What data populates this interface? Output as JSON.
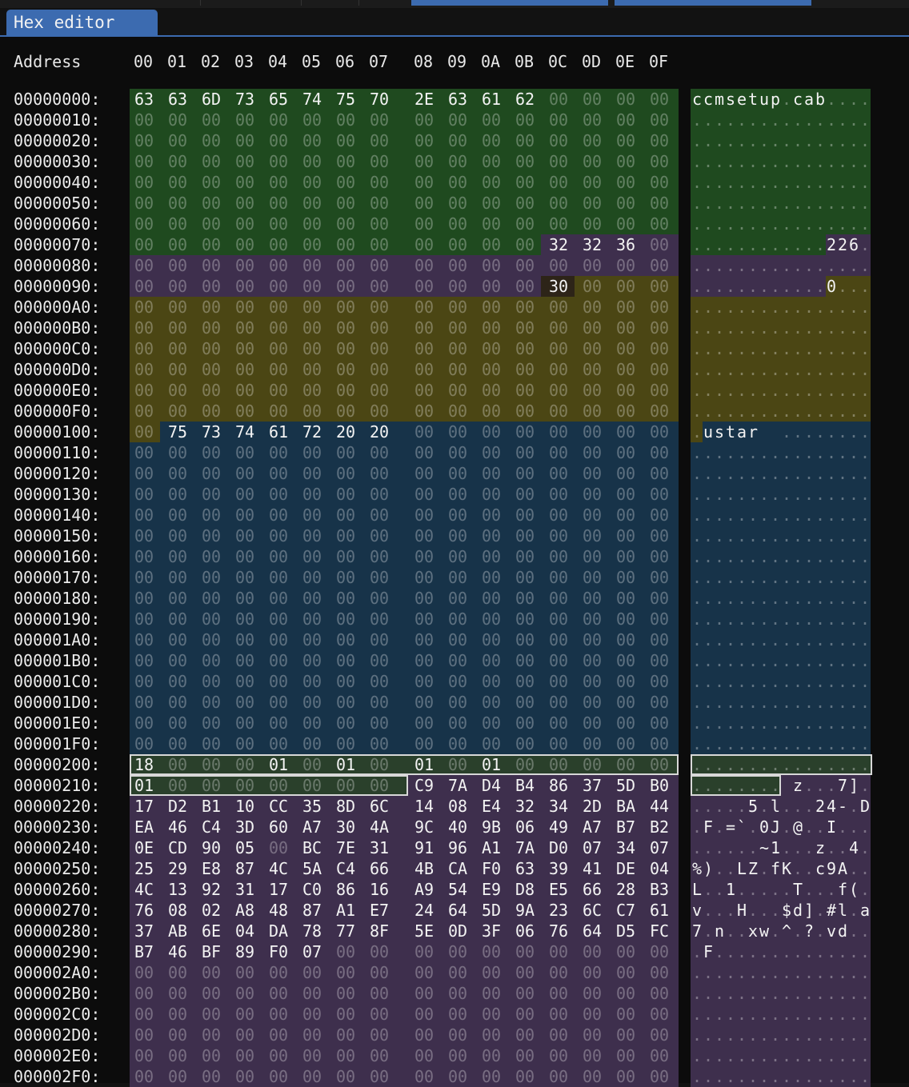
{
  "tab": {
    "label": "Hex editor"
  },
  "header": {
    "address_label": "Address",
    "columns": [
      "00",
      "01",
      "02",
      "03",
      "04",
      "05",
      "06",
      "07",
      "08",
      "09",
      "0A",
      "0B",
      "0C",
      "0D",
      "0E",
      "0F"
    ]
  },
  "colors": {
    "tab_accent": "#3c6bb0",
    "region_green": "#1f4a1f",
    "region_purple": "#3e2f4d",
    "region_olive": "#4b4614",
    "region_blue": "#173349",
    "region_selected": "#2a402b"
  },
  "regions": [
    {
      "color": "region_green",
      "start": 0,
      "end": 124
    },
    {
      "color": "region_purple",
      "start": 124,
      "end": 155
    },
    {
      "color": "region_olive",
      "start": 156,
      "end": 256
    },
    {
      "color": "region_blue",
      "start": 257,
      "end": 511
    },
    {
      "color": "region_selected",
      "start": 512,
      "end": 535
    },
    {
      "color": "region_purple",
      "start": 536,
      "end": 767
    }
  ],
  "selection": {
    "start": 512,
    "end": 535
  },
  "highlight_cells": [
    156
  ],
  "rows": [
    {
      "address": "00000000:",
      "bytes": [
        "63",
        "63",
        "6D",
        "73",
        "65",
        "74",
        "75",
        "70",
        "2E",
        "63",
        "61",
        "62",
        "00",
        "00",
        "00",
        "00"
      ],
      "ascii": "ccmsetup.cab...."
    },
    {
      "address": "00000010:",
      "bytes": [
        "00",
        "00",
        "00",
        "00",
        "00",
        "00",
        "00",
        "00",
        "00",
        "00",
        "00",
        "00",
        "00",
        "00",
        "00",
        "00"
      ],
      "ascii": "................"
    },
    {
      "address": "00000020:",
      "bytes": [
        "00",
        "00",
        "00",
        "00",
        "00",
        "00",
        "00",
        "00",
        "00",
        "00",
        "00",
        "00",
        "00",
        "00",
        "00",
        "00"
      ],
      "ascii": "................"
    },
    {
      "address": "00000030:",
      "bytes": [
        "00",
        "00",
        "00",
        "00",
        "00",
        "00",
        "00",
        "00",
        "00",
        "00",
        "00",
        "00",
        "00",
        "00",
        "00",
        "00"
      ],
      "ascii": "................"
    },
    {
      "address": "00000040:",
      "bytes": [
        "00",
        "00",
        "00",
        "00",
        "00",
        "00",
        "00",
        "00",
        "00",
        "00",
        "00",
        "00",
        "00",
        "00",
        "00",
        "00"
      ],
      "ascii": "................"
    },
    {
      "address": "00000050:",
      "bytes": [
        "00",
        "00",
        "00",
        "00",
        "00",
        "00",
        "00",
        "00",
        "00",
        "00",
        "00",
        "00",
        "00",
        "00",
        "00",
        "00"
      ],
      "ascii": "................"
    },
    {
      "address": "00000060:",
      "bytes": [
        "00",
        "00",
        "00",
        "00",
        "00",
        "00",
        "00",
        "00",
        "00",
        "00",
        "00",
        "00",
        "00",
        "00",
        "00",
        "00"
      ],
      "ascii": "................"
    },
    {
      "address": "00000070:",
      "bytes": [
        "00",
        "00",
        "00",
        "00",
        "00",
        "00",
        "00",
        "00",
        "00",
        "00",
        "00",
        "00",
        "32",
        "32",
        "36",
        "00"
      ],
      "ascii": "............226."
    },
    {
      "address": "00000080:",
      "bytes": [
        "00",
        "00",
        "00",
        "00",
        "00",
        "00",
        "00",
        "00",
        "00",
        "00",
        "00",
        "00",
        "00",
        "00",
        "00",
        "00"
      ],
      "ascii": "................"
    },
    {
      "address": "00000090:",
      "bytes": [
        "00",
        "00",
        "00",
        "00",
        "00",
        "00",
        "00",
        "00",
        "00",
        "00",
        "00",
        "00",
        "30",
        "00",
        "00",
        "00"
      ],
      "ascii": "............0..."
    },
    {
      "address": "000000A0:",
      "bytes": [
        "00",
        "00",
        "00",
        "00",
        "00",
        "00",
        "00",
        "00",
        "00",
        "00",
        "00",
        "00",
        "00",
        "00",
        "00",
        "00"
      ],
      "ascii": "................"
    },
    {
      "address": "000000B0:",
      "bytes": [
        "00",
        "00",
        "00",
        "00",
        "00",
        "00",
        "00",
        "00",
        "00",
        "00",
        "00",
        "00",
        "00",
        "00",
        "00",
        "00"
      ],
      "ascii": "................"
    },
    {
      "address": "000000C0:",
      "bytes": [
        "00",
        "00",
        "00",
        "00",
        "00",
        "00",
        "00",
        "00",
        "00",
        "00",
        "00",
        "00",
        "00",
        "00",
        "00",
        "00"
      ],
      "ascii": "................"
    },
    {
      "address": "000000D0:",
      "bytes": [
        "00",
        "00",
        "00",
        "00",
        "00",
        "00",
        "00",
        "00",
        "00",
        "00",
        "00",
        "00",
        "00",
        "00",
        "00",
        "00"
      ],
      "ascii": "................"
    },
    {
      "address": "000000E0:",
      "bytes": [
        "00",
        "00",
        "00",
        "00",
        "00",
        "00",
        "00",
        "00",
        "00",
        "00",
        "00",
        "00",
        "00",
        "00",
        "00",
        "00"
      ],
      "ascii": "................"
    },
    {
      "address": "000000F0:",
      "bytes": [
        "00",
        "00",
        "00",
        "00",
        "00",
        "00",
        "00",
        "00",
        "00",
        "00",
        "00",
        "00",
        "00",
        "00",
        "00",
        "00"
      ],
      "ascii": "................"
    },
    {
      "address": "00000100:",
      "bytes": [
        "00",
        "75",
        "73",
        "74",
        "61",
        "72",
        "20",
        "20",
        "00",
        "00",
        "00",
        "00",
        "00",
        "00",
        "00",
        "00"
      ],
      "ascii": ".ustar  ........"
    },
    {
      "address": "00000110:",
      "bytes": [
        "00",
        "00",
        "00",
        "00",
        "00",
        "00",
        "00",
        "00",
        "00",
        "00",
        "00",
        "00",
        "00",
        "00",
        "00",
        "00"
      ],
      "ascii": "................"
    },
    {
      "address": "00000120:",
      "bytes": [
        "00",
        "00",
        "00",
        "00",
        "00",
        "00",
        "00",
        "00",
        "00",
        "00",
        "00",
        "00",
        "00",
        "00",
        "00",
        "00"
      ],
      "ascii": "................"
    },
    {
      "address": "00000130:",
      "bytes": [
        "00",
        "00",
        "00",
        "00",
        "00",
        "00",
        "00",
        "00",
        "00",
        "00",
        "00",
        "00",
        "00",
        "00",
        "00",
        "00"
      ],
      "ascii": "................"
    },
    {
      "address": "00000140:",
      "bytes": [
        "00",
        "00",
        "00",
        "00",
        "00",
        "00",
        "00",
        "00",
        "00",
        "00",
        "00",
        "00",
        "00",
        "00",
        "00",
        "00"
      ],
      "ascii": "................"
    },
    {
      "address": "00000150:",
      "bytes": [
        "00",
        "00",
        "00",
        "00",
        "00",
        "00",
        "00",
        "00",
        "00",
        "00",
        "00",
        "00",
        "00",
        "00",
        "00",
        "00"
      ],
      "ascii": "................"
    },
    {
      "address": "00000160:",
      "bytes": [
        "00",
        "00",
        "00",
        "00",
        "00",
        "00",
        "00",
        "00",
        "00",
        "00",
        "00",
        "00",
        "00",
        "00",
        "00",
        "00"
      ],
      "ascii": "................"
    },
    {
      "address": "00000170:",
      "bytes": [
        "00",
        "00",
        "00",
        "00",
        "00",
        "00",
        "00",
        "00",
        "00",
        "00",
        "00",
        "00",
        "00",
        "00",
        "00",
        "00"
      ],
      "ascii": "................"
    },
    {
      "address": "00000180:",
      "bytes": [
        "00",
        "00",
        "00",
        "00",
        "00",
        "00",
        "00",
        "00",
        "00",
        "00",
        "00",
        "00",
        "00",
        "00",
        "00",
        "00"
      ],
      "ascii": "................"
    },
    {
      "address": "00000190:",
      "bytes": [
        "00",
        "00",
        "00",
        "00",
        "00",
        "00",
        "00",
        "00",
        "00",
        "00",
        "00",
        "00",
        "00",
        "00",
        "00",
        "00"
      ],
      "ascii": "................"
    },
    {
      "address": "000001A0:",
      "bytes": [
        "00",
        "00",
        "00",
        "00",
        "00",
        "00",
        "00",
        "00",
        "00",
        "00",
        "00",
        "00",
        "00",
        "00",
        "00",
        "00"
      ],
      "ascii": "................"
    },
    {
      "address": "000001B0:",
      "bytes": [
        "00",
        "00",
        "00",
        "00",
        "00",
        "00",
        "00",
        "00",
        "00",
        "00",
        "00",
        "00",
        "00",
        "00",
        "00",
        "00"
      ],
      "ascii": "................"
    },
    {
      "address": "000001C0:",
      "bytes": [
        "00",
        "00",
        "00",
        "00",
        "00",
        "00",
        "00",
        "00",
        "00",
        "00",
        "00",
        "00",
        "00",
        "00",
        "00",
        "00"
      ],
      "ascii": "................"
    },
    {
      "address": "000001D0:",
      "bytes": [
        "00",
        "00",
        "00",
        "00",
        "00",
        "00",
        "00",
        "00",
        "00",
        "00",
        "00",
        "00",
        "00",
        "00",
        "00",
        "00"
      ],
      "ascii": "................"
    },
    {
      "address": "000001E0:",
      "bytes": [
        "00",
        "00",
        "00",
        "00",
        "00",
        "00",
        "00",
        "00",
        "00",
        "00",
        "00",
        "00",
        "00",
        "00",
        "00",
        "00"
      ],
      "ascii": "................"
    },
    {
      "address": "000001F0:",
      "bytes": [
        "00",
        "00",
        "00",
        "00",
        "00",
        "00",
        "00",
        "00",
        "00",
        "00",
        "00",
        "00",
        "00",
        "00",
        "00",
        "00"
      ],
      "ascii": "................"
    },
    {
      "address": "00000200:",
      "bytes": [
        "18",
        "00",
        "00",
        "00",
        "01",
        "00",
        "01",
        "00",
        "01",
        "00",
        "01",
        "00",
        "00",
        "00",
        "00",
        "00"
      ],
      "ascii": "................"
    },
    {
      "address": "00000210:",
      "bytes": [
        "01",
        "00",
        "00",
        "00",
        "00",
        "00",
        "00",
        "00",
        "C9",
        "7A",
        "D4",
        "B4",
        "86",
        "37",
        "5D",
        "B0"
      ],
      "ascii": "........ z...7]."
    },
    {
      "address": "00000220:",
      "bytes": [
        "17",
        "D2",
        "B1",
        "10",
        "CC",
        "35",
        "8D",
        "6C",
        "14",
        "08",
        "E4",
        "32",
        "34",
        "2D",
        "BA",
        "44"
      ],
      "ascii": ".....5.l...24-.D"
    },
    {
      "address": "00000230:",
      "bytes": [
        "EA",
        "46",
        "C4",
        "3D",
        "60",
        "A7",
        "30",
        "4A",
        "9C",
        "40",
        "9B",
        "06",
        "49",
        "A7",
        "B7",
        "B2"
      ],
      "ascii": ".F.=`.0J.@..I..."
    },
    {
      "address": "00000240:",
      "bytes": [
        "0E",
        "CD",
        "90",
        "05",
        "00",
        "BC",
        "7E",
        "31",
        "91",
        "96",
        "A1",
        "7A",
        "D0",
        "07",
        "34",
        "07"
      ],
      "ascii": "......~1...z..4."
    },
    {
      "address": "00000250:",
      "bytes": [
        "25",
        "29",
        "E8",
        "87",
        "4C",
        "5A",
        "C4",
        "66",
        "4B",
        "CA",
        "F0",
        "63",
        "39",
        "41",
        "DE",
        "04"
      ],
      "ascii": "%)..LZ.fK..c9A.."
    },
    {
      "address": "00000260:",
      "bytes": [
        "4C",
        "13",
        "92",
        "31",
        "17",
        "C0",
        "86",
        "16",
        "A9",
        "54",
        "E9",
        "D8",
        "E5",
        "66",
        "28",
        "B3"
      ],
      "ascii": "L..1.....T...f(."
    },
    {
      "address": "00000270:",
      "bytes": [
        "76",
        "08",
        "02",
        "A8",
        "48",
        "87",
        "A1",
        "E7",
        "24",
        "64",
        "5D",
        "9A",
        "23",
        "6C",
        "C7",
        "61"
      ],
      "ascii": "v...H...$d].#l.a"
    },
    {
      "address": "00000280:",
      "bytes": [
        "37",
        "AB",
        "6E",
        "04",
        "DA",
        "78",
        "77",
        "8F",
        "5E",
        "0D",
        "3F",
        "06",
        "76",
        "64",
        "D5",
        "FC"
      ],
      "ascii": "7.n..xw.^.?.vd.."
    },
    {
      "address": "00000290:",
      "bytes": [
        "B7",
        "46",
        "BF",
        "89",
        "F0",
        "07",
        "00",
        "00",
        "00",
        "00",
        "00",
        "00",
        "00",
        "00",
        "00",
        "00"
      ],
      "ascii": ".F.............."
    },
    {
      "address": "000002A0:",
      "bytes": [
        "00",
        "00",
        "00",
        "00",
        "00",
        "00",
        "00",
        "00",
        "00",
        "00",
        "00",
        "00",
        "00",
        "00",
        "00",
        "00"
      ],
      "ascii": "................"
    },
    {
      "address": "000002B0:",
      "bytes": [
        "00",
        "00",
        "00",
        "00",
        "00",
        "00",
        "00",
        "00",
        "00",
        "00",
        "00",
        "00",
        "00",
        "00",
        "00",
        "00"
      ],
      "ascii": "................"
    },
    {
      "address": "000002C0:",
      "bytes": [
        "00",
        "00",
        "00",
        "00",
        "00",
        "00",
        "00",
        "00",
        "00",
        "00",
        "00",
        "00",
        "00",
        "00",
        "00",
        "00"
      ],
      "ascii": "................"
    },
    {
      "address": "000002D0:",
      "bytes": [
        "00",
        "00",
        "00",
        "00",
        "00",
        "00",
        "00",
        "00",
        "00",
        "00",
        "00",
        "00",
        "00",
        "00",
        "00",
        "00"
      ],
      "ascii": "................"
    },
    {
      "address": "000002E0:",
      "bytes": [
        "00",
        "00",
        "00",
        "00",
        "00",
        "00",
        "00",
        "00",
        "00",
        "00",
        "00",
        "00",
        "00",
        "00",
        "00",
        "00"
      ],
      "ascii": "................"
    },
    {
      "address": "000002F0:",
      "bytes": [
        "00",
        "00",
        "00",
        "00",
        "00",
        "00",
        "00",
        "00",
        "00",
        "00",
        "00",
        "00",
        "00",
        "00",
        "00",
        "00"
      ],
      "ascii": "................"
    }
  ]
}
